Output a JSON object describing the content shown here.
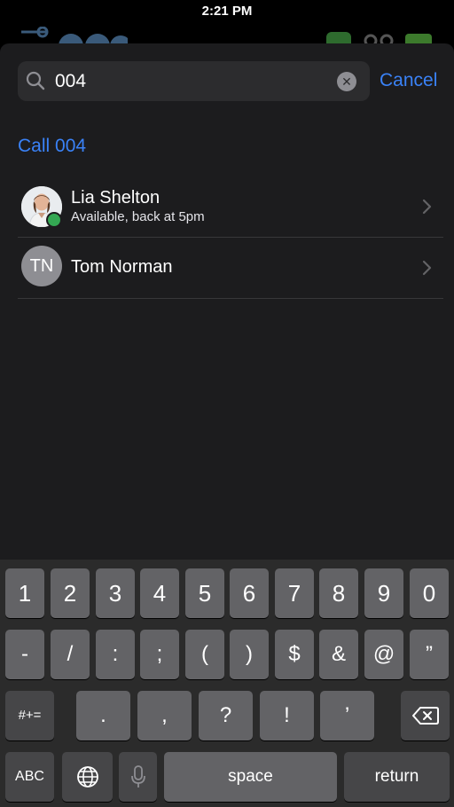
{
  "status_bar": {
    "time": "2:21 PM"
  },
  "search": {
    "query": "004",
    "placeholder": "",
    "cancel_label": "Cancel"
  },
  "call_action": {
    "label": "Call 004"
  },
  "contacts": [
    {
      "name": "Lia Shelton",
      "status": "Available, back at 5pm",
      "presence_color": "#34a853"
    },
    {
      "name": "Tom Norman",
      "initials": "TN",
      "status": ""
    }
  ],
  "keyboard": {
    "row1": [
      "1",
      "2",
      "3",
      "4",
      "5",
      "6",
      "7",
      "8",
      "9",
      "0"
    ],
    "row2": [
      "-",
      "/",
      ":",
      ";",
      "(",
      ")",
      "$",
      "&",
      "@",
      "”"
    ],
    "row3": {
      "toggle": "#+=",
      "keys": [
        ".",
        ",",
        "?",
        "!",
        "’"
      ]
    },
    "row4": {
      "abc": "ABC",
      "space": "space",
      "return": "return"
    }
  },
  "colors": {
    "accent": "#3a82f7",
    "sheet": "#1c1c1e",
    "key": "#636366",
    "key_fn": "#464648"
  }
}
